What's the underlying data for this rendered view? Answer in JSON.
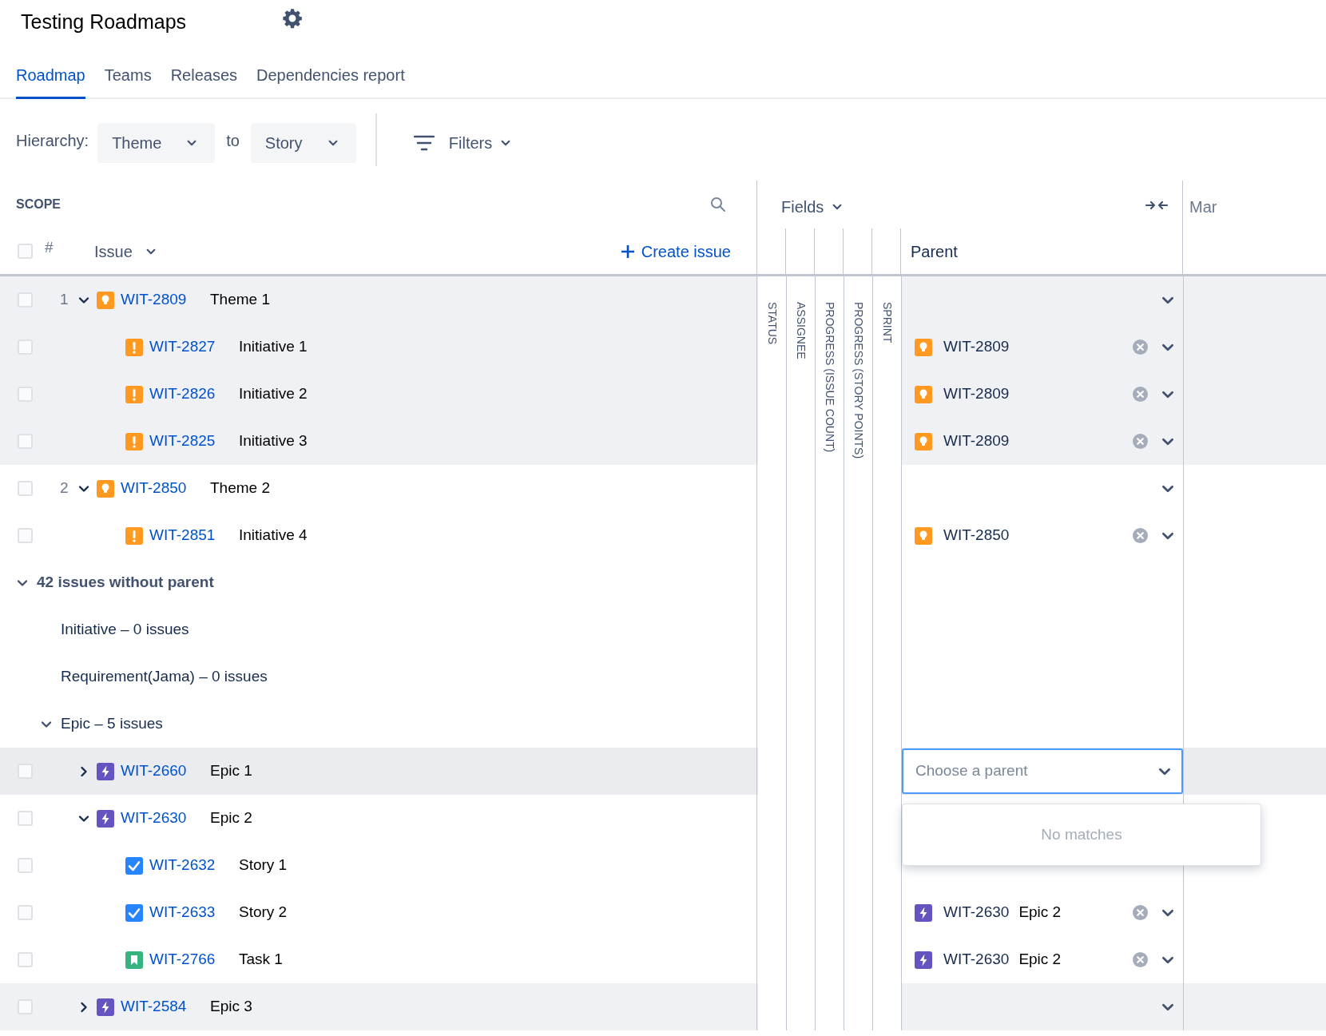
{
  "title": "Testing Roadmaps",
  "tabs": [
    {
      "label": "Roadmap",
      "selected": true
    },
    {
      "label": "Teams",
      "selected": false
    },
    {
      "label": "Releases",
      "selected": false
    },
    {
      "label": "Dependencies report",
      "selected": false
    }
  ],
  "hierarchy": {
    "label": "Hierarchy:",
    "from": "Theme",
    "joiner": "to",
    "to": "Story"
  },
  "filters": "Filters",
  "scope": {
    "title": "SCOPE",
    "number_header": "#",
    "issue_header": "Issue",
    "create": "Create issue",
    "select_all_checked": false
  },
  "fields": {
    "label": "Fields",
    "columns": [
      "STATUS",
      "ASSIGNEE",
      "PROGRESS (ISSUE COUNT)",
      "PROGRESS (STORY POINTS)",
      "SPRINT"
    ],
    "parent_header": "Parent"
  },
  "timeline": {
    "month": "Mar"
  },
  "issues": [
    {
      "number": "1",
      "kind": "theme",
      "key": "WIT-2809",
      "summary": "Theme 1",
      "expanded": true,
      "checked": false,
      "highlighted": true,
      "parent_menu": true,
      "children": [
        {
          "kind": "initiative",
          "key": "WIT-2827",
          "summary": "Initiative 1",
          "checked": false,
          "highlighted": true,
          "parent_menu": true,
          "parent": {
            "kind": "theme",
            "key": "WIT-2809"
          }
        },
        {
          "kind": "initiative",
          "key": "WIT-2826",
          "summary": "Initiative 2",
          "checked": false,
          "highlighted": true,
          "parent_menu": true,
          "parent": {
            "kind": "theme",
            "key": "WIT-2809"
          }
        },
        {
          "kind": "initiative",
          "key": "WIT-2825",
          "summary": "Initiative 3",
          "checked": false,
          "highlighted": true,
          "parent_menu": true,
          "parent": {
            "kind": "theme",
            "key": "WIT-2809"
          }
        }
      ]
    },
    {
      "number": "2",
      "kind": "theme",
      "key": "WIT-2850",
      "summary": "Theme 2",
      "expanded": true,
      "checked": false,
      "highlighted": false,
      "parent_menu": true,
      "children": [
        {
          "kind": "initiative",
          "key": "WIT-2851",
          "summary": "Initiative 4",
          "checked": false,
          "highlighted": false,
          "parent_menu": true,
          "parent": {
            "kind": "theme",
            "key": "WIT-2850"
          }
        }
      ]
    }
  ],
  "without_parent": {
    "label": "42 issues without parent",
    "expanded": true,
    "groups": [
      {
        "label": "Initiative – 0 issues"
      },
      {
        "label": "Requirement(Jama) – 0 issues"
      },
      {
        "label": "Epic – 5 issues",
        "expanded": true,
        "issues": [
          {
            "kind": "epic",
            "key": "WIT-2660",
            "summary": "Epic 1",
            "expanded": false,
            "checked": false,
            "selected": true,
            "parent_field": {
              "placeholder": "Choose a parent",
              "popup": "No matches"
            }
          },
          {
            "kind": "epic",
            "key": "WIT-2630",
            "summary": "Epic 2",
            "expanded": true,
            "checked": false,
            "highlighted": false,
            "children": [
              {
                "kind": "story",
                "key": "WIT-2632",
                "summary": "Story 1",
                "checked": false,
                "highlighted": false
              },
              {
                "kind": "story",
                "key": "WIT-2633",
                "summary": "Story 2",
                "checked": false,
                "highlighted": false,
                "parent_menu": true,
                "parent": {
                  "kind": "epic",
                  "key": "WIT-2630",
                  "summary": "Epic 2"
                }
              },
              {
                "kind": "task",
                "key": "WIT-2766",
                "summary": "Task 1",
                "checked": false,
                "highlighted": false,
                "parent_menu": true,
                "parent": {
                  "kind": "epic",
                  "key": "WIT-2630",
                  "summary": "Epic 2"
                }
              }
            ]
          },
          {
            "kind": "epic",
            "key": "WIT-2584",
            "summary": "Epic 3",
            "expanded": false,
            "checked": false,
            "highlighted": true,
            "parent_menu": true
          }
        ]
      }
    ]
  }
}
